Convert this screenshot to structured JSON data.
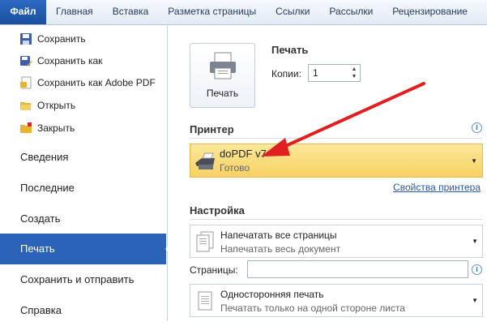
{
  "ribbon": {
    "tabs": [
      "Файл",
      "Главная",
      "Вставка",
      "Разметка страницы",
      "Ссылки",
      "Рассылки",
      "Рецензирование"
    ]
  },
  "sidebar": {
    "commands": [
      {
        "label": "Сохранить",
        "icon": "save-icon"
      },
      {
        "label": "Сохранить как",
        "icon": "save-as-icon"
      },
      {
        "label": "Сохранить как Adobe PDF",
        "icon": "adobe-pdf-icon"
      },
      {
        "label": "Открыть",
        "icon": "open-folder-icon"
      },
      {
        "label": "Закрыть",
        "icon": "close-folder-icon"
      }
    ],
    "sections": [
      "Сведения",
      "Последние",
      "Создать",
      "Печать",
      "Сохранить и отправить",
      "Справка"
    ],
    "active_section": "Печать"
  },
  "print": {
    "title": "Печать",
    "button_label": "Печать",
    "copies_label": "Копии:",
    "copies_value": "1"
  },
  "printer": {
    "title": "Принтер",
    "name": "doPDF v7",
    "status": "Готово",
    "properties_link": "Свойства принтера"
  },
  "settings": {
    "title": "Настройка",
    "range": {
      "title": "Напечатать все страницы",
      "subtitle": "Напечатать весь документ"
    },
    "pages_label": "Страницы:",
    "pages_value": "",
    "sides": {
      "title": "Односторонняя печать",
      "subtitle": "Печатать только на одной стороне листа"
    }
  },
  "colors": {
    "accent": "#2a63b8",
    "printer_highlight": "#f7d164",
    "annotation_arrow": "#e02020"
  }
}
